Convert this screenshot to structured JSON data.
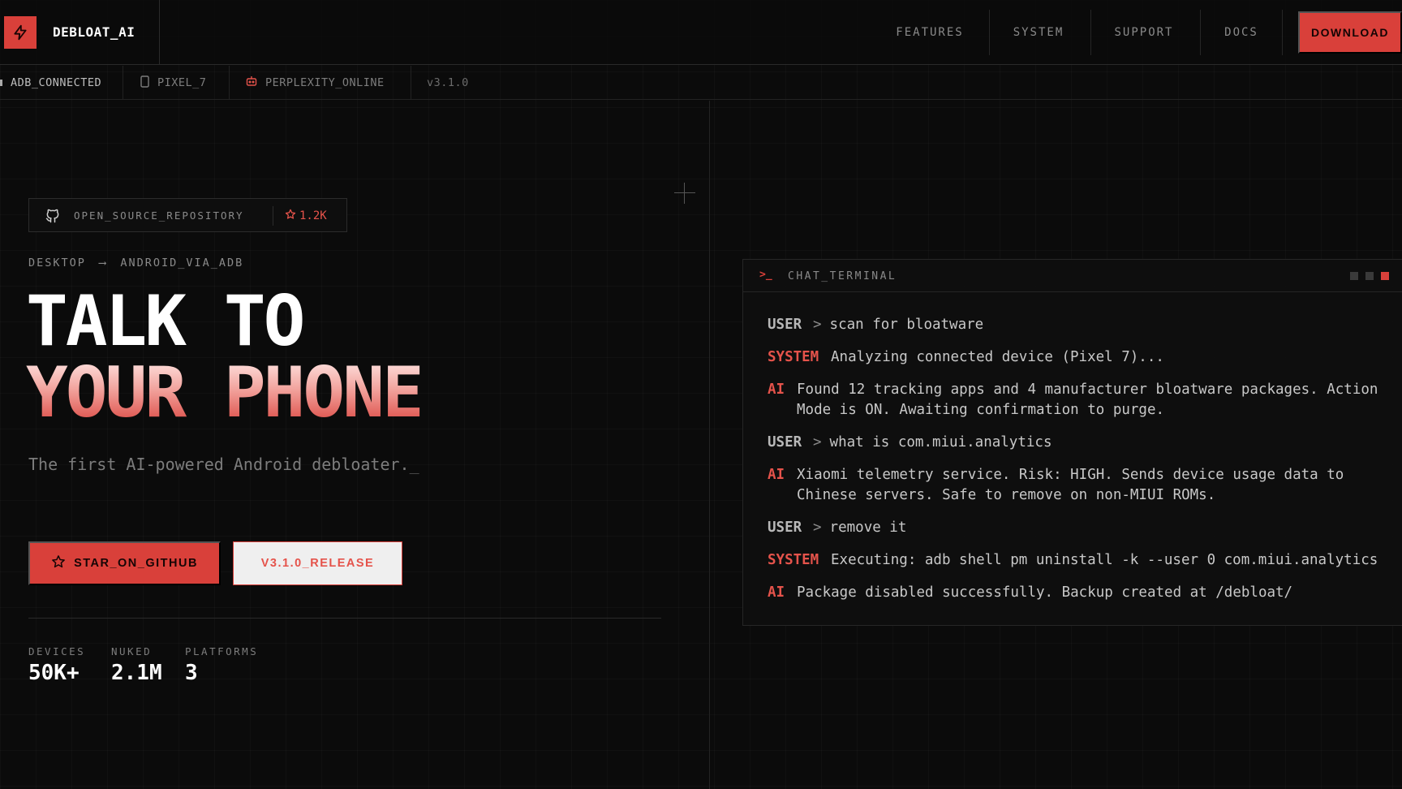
{
  "nav": {
    "brand": "DEBLOAT_AI",
    "links": [
      "FEATURES",
      "SYSTEM",
      "SUPPORT",
      "DOCS"
    ],
    "download": "DOWNLOAD"
  },
  "status": {
    "adb": "ADB_CONNECTED",
    "device": "PIXEL_7",
    "ai": "PERPLEXITY_ONLINE",
    "version": "v3.1.0"
  },
  "hero": {
    "repo_label": "OPEN_SOURCE_REPOSITORY",
    "repo_stars": "1.2K",
    "breadcrumb_from": "DESKTOP",
    "breadcrumb_arrow": "⟶",
    "breadcrumb_to": "ANDROID_VIA_ADB",
    "title_line1": "TALK TO",
    "title_line2": "YOUR PHONE",
    "subtitle": "The first AI-powered Android debloater.",
    "cursor": "_",
    "btn_primary": "STAR_ON_GITHUB",
    "btn_secondary": "V3.1.0_RELEASE"
  },
  "stats": [
    {
      "label": "DEVICES",
      "value": "50K+"
    },
    {
      "label": "NUKED",
      "value": "2.1M"
    },
    {
      "label": "PLATFORMS",
      "value": "3"
    }
  ],
  "terminal": {
    "prompt_icon": ">_",
    "title": "CHAT_TERMINAL",
    "messages": [
      {
        "role": "USER",
        "text": "scan for bloatware"
      },
      {
        "role": "SYSTEM",
        "text": "Analyzing connected device (Pixel 7)..."
      },
      {
        "role": "AI",
        "text": "Found 12 tracking apps and 4 manufacturer bloatware packages. Action Mode is ON. Awaiting confirmation to purge."
      },
      {
        "role": "USER",
        "text": "what is com.miui.analytics"
      },
      {
        "role": "AI",
        "text": "Xiaomi telemetry service. Risk: HIGH. Sends device usage data to Chinese servers. Safe to remove on non-MIUI ROMs."
      },
      {
        "role": "USER",
        "text": "remove it"
      },
      {
        "role": "SYSTEM",
        "text": "Executing: adb shell pm uninstall -k --user 0 com.miui.analytics"
      },
      {
        "role": "AI",
        "text": "Package disabled successfully. Backup created at /debloat/"
      }
    ],
    "user_prompt": ">"
  },
  "colors": {
    "accent": "#d9403a",
    "accent_text": "#e5534b",
    "background": "#0b0b0b"
  }
}
